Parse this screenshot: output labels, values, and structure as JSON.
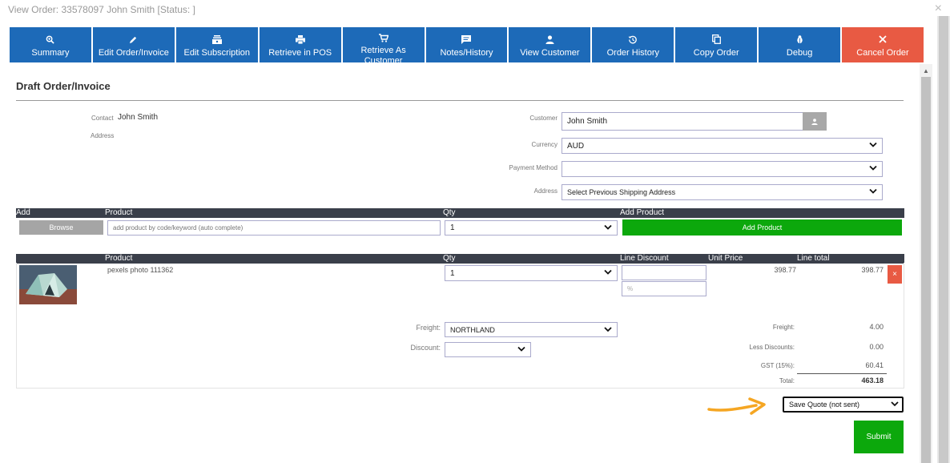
{
  "window": {
    "title": "View Order: 33578097 John Smith [Status: ]",
    "close_glyph": "×"
  },
  "toolbar": [
    {
      "label": "Summary",
      "icon": "zoom-icon"
    },
    {
      "label": "Edit Order/Invoice",
      "icon": "pencil-icon"
    },
    {
      "label": "Edit Subscription",
      "icon": "subscription-icon"
    },
    {
      "label": "Retrieve in POS",
      "icon": "printer-icon"
    },
    {
      "label": "Retrieve As Customer",
      "icon": "cart-icon"
    },
    {
      "label": "Notes/History",
      "icon": "chat-icon"
    },
    {
      "label": "View Customer",
      "icon": "person-icon"
    },
    {
      "label": "Order History",
      "icon": "history-icon"
    },
    {
      "label": "Copy Order",
      "icon": "copy-icon"
    },
    {
      "label": "Debug",
      "icon": "bug-icon"
    },
    {
      "label": "Cancel Order",
      "icon": "close-icon"
    }
  ],
  "page_title": "Draft Order/Invoice",
  "contact": {
    "contact_label": "Contact",
    "contact_value": "John Smith",
    "address_label": "Address"
  },
  "form": {
    "customer_label": "Customer",
    "customer_value": "John Smith",
    "currency_label": "Currency",
    "currency_value": "AUD",
    "payment_label": "Payment Method",
    "payment_value": "",
    "address_label": "Address",
    "address_value": "Select Previous Shipping Address"
  },
  "add_table": {
    "headers": {
      "add": "Add",
      "product": "Product",
      "qty": "Qty",
      "add_product": "Add Product"
    },
    "browse_label": "Browse",
    "product_placeholder": "add product by code/keyword (auto complete)",
    "qty_value": "1",
    "add_button_label": "Add Product"
  },
  "lines_table": {
    "headers": {
      "product": "Product",
      "qty": "Qty",
      "line_discount": "Line Discount",
      "unit_price": "Unit Price",
      "line_total": "Line total"
    },
    "rows": [
      {
        "product": "pexels photo 111362",
        "qty": "1",
        "discount_value": "",
        "discount_pct_placeholder": "%",
        "unit_price": "398.77",
        "line_total": "398.77",
        "remove_glyph": "×"
      }
    ]
  },
  "freight": {
    "freight_label": "Freight:",
    "freight_value": "NORTHLAND",
    "discount_label": "Discount:",
    "discount_value": ""
  },
  "summary": {
    "freight_label": "Freight:",
    "freight_value": "4.00",
    "discounts_label": "Less Discounts:",
    "discounts_value": "0.00",
    "gst_label": "GST (15%):",
    "gst_value": "60.41",
    "total_label": "Total:",
    "total_value": "463.18"
  },
  "status_select_value": "Save Quote (not sent)",
  "submit_label": "Submit",
  "colors": {
    "toolbar_blue": "#1d6ab8",
    "cancel_red": "#e85a43",
    "green": "#0ca80c",
    "arrow_orange": "#f5a623",
    "header_dark": "#3a3f4a"
  }
}
